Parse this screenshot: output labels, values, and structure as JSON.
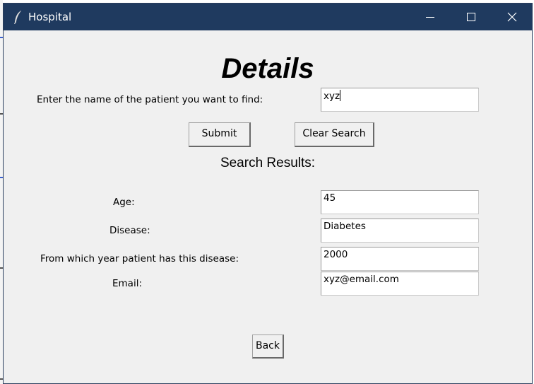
{
  "window": {
    "title": "Hospital",
    "icon": "feather-icon",
    "controls": [
      "minimize-icon",
      "maximize-icon",
      "close-icon"
    ]
  },
  "heading": "Details",
  "search": {
    "prompt": "Enter the name of the patient you want to find:",
    "value": "xyz"
  },
  "buttons": {
    "submit": "Submit",
    "clear": "Clear Search",
    "back": "Back"
  },
  "results_title": "Search Results:",
  "results": {
    "age_label": "Age:",
    "age_value": "45",
    "disease_label": "Disease:",
    "disease_value": "Diabetes",
    "year_label": "From which year patient has this disease:",
    "year_value": "2000",
    "email_label": "Email:",
    "email_value": "xyz@email.com"
  },
  "colors": {
    "titlebar": "#1f3a5f",
    "window_bg": "#f0f0f0"
  }
}
